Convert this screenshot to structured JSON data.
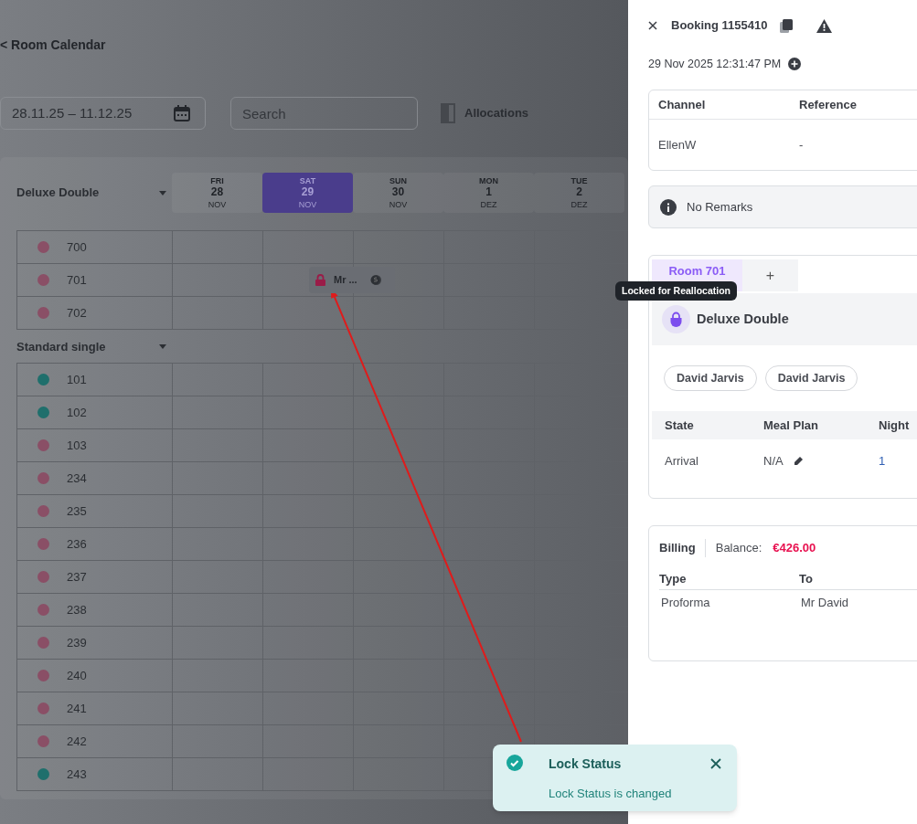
{
  "header": {
    "back_link": "< Room Calendar"
  },
  "toolbar": {
    "date_range": "28.11.25 – 11.12.25",
    "search": {
      "placeholder": "Search"
    },
    "allocations": "Allocations"
  },
  "calendar": {
    "days": [
      {
        "weekday": "FRI",
        "day": "28",
        "month": "NOV",
        "selected": false
      },
      {
        "weekday": "SAT",
        "day": "29",
        "month": "NOV",
        "selected": true
      },
      {
        "weekday": "SUN",
        "day": "30",
        "month": "NOV",
        "selected": false
      },
      {
        "weekday": "MON",
        "day": "1",
        "month": "DEZ",
        "selected": false
      },
      {
        "weekday": "TUE",
        "day": "2",
        "month": "DEZ",
        "selected": false
      }
    ],
    "groups": [
      {
        "name": "Deluxe Double",
        "rooms": [
          {
            "number": "700",
            "color": "#8a4f66"
          },
          {
            "number": "701",
            "color": "#8a4f66",
            "booking": {
              "guest": "Mr ...",
              "locked": true
            }
          },
          {
            "number": "702",
            "color": "#8a4f66"
          }
        ]
      },
      {
        "name": "Standard single",
        "rooms": [
          {
            "number": "101",
            "color": "#1f6f6c"
          },
          {
            "number": "102",
            "color": "#1f6f6c"
          },
          {
            "number": "103",
            "color": "#8a4f66"
          },
          {
            "number": "234",
            "color": "#8a4f66"
          },
          {
            "number": "235",
            "color": "#8a4f66"
          },
          {
            "number": "236",
            "color": "#8a4f66"
          },
          {
            "number": "237",
            "color": "#8a4f66"
          },
          {
            "number": "238",
            "color": "#8a4f66"
          },
          {
            "number": "239",
            "color": "#8a4f66"
          },
          {
            "number": "240",
            "color": "#8a4f66"
          },
          {
            "number": "241",
            "color": "#8a4f66"
          },
          {
            "number": "242",
            "color": "#8a4f66"
          },
          {
            "number": "243",
            "color": "#1f6f6c"
          }
        ]
      }
    ]
  },
  "booking_panel": {
    "title": "Booking 1155410",
    "created": "29 Nov 2025 12:31:47 PM",
    "info_table": {
      "columns": [
        "Channel",
        "Reference"
      ],
      "row": [
        "EllenW",
        "-"
      ]
    },
    "remarks": "No Remarks",
    "room_tabs": [
      {
        "label": "Room 701",
        "selected": true
      },
      {
        "label": "+",
        "selected": false
      }
    ],
    "tooltip": "Locked for Reallocation",
    "room_type": "Deluxe Double",
    "guests": [
      "David Jarvis",
      "David Jarvis"
    ],
    "stay_table": {
      "columns": [
        "State",
        "Meal Plan",
        "Night"
      ],
      "row": [
        "Arrival",
        "N/A",
        "1"
      ]
    },
    "billing": {
      "title": "Billing",
      "balance_label": "Balance:",
      "balance": "€426.00",
      "columns": [
        "Type",
        "To"
      ],
      "rows": [
        [
          "Proforma",
          "Mr David"
        ]
      ]
    }
  },
  "toast": {
    "title": "Lock Status",
    "message": "Lock Status is changed"
  }
}
